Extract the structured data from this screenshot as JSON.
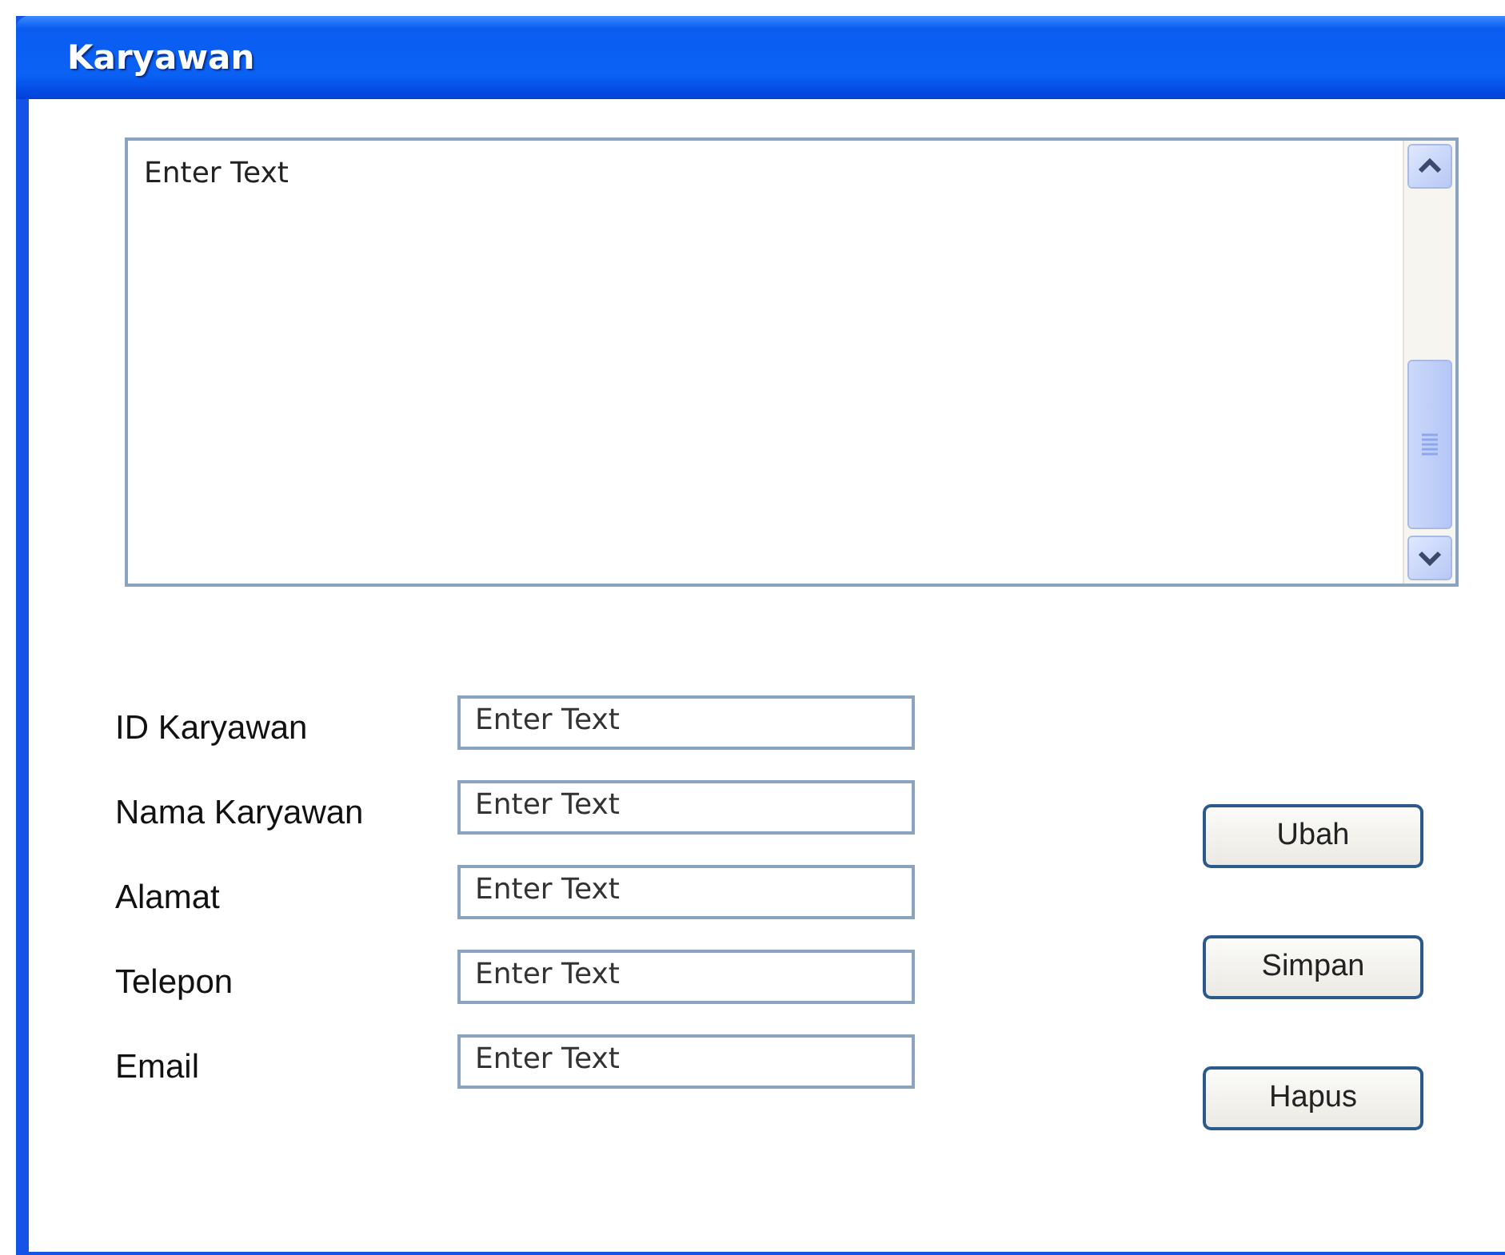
{
  "window": {
    "title": "Karyawan"
  },
  "list_box": {
    "placeholder": "Enter Text"
  },
  "form": {
    "fields": [
      {
        "label": "ID Karyawan",
        "placeholder": "Enter Text"
      },
      {
        "label": "Nama Karyawan",
        "placeholder": "Enter Text"
      },
      {
        "label": "Alamat",
        "placeholder": "Enter Text"
      },
      {
        "label": "Telepon",
        "placeholder": "Enter Text"
      },
      {
        "label": "Email",
        "placeholder": "Enter Text"
      }
    ]
  },
  "buttons": [
    "Ubah",
    "Simpan",
    "Hapus"
  ]
}
